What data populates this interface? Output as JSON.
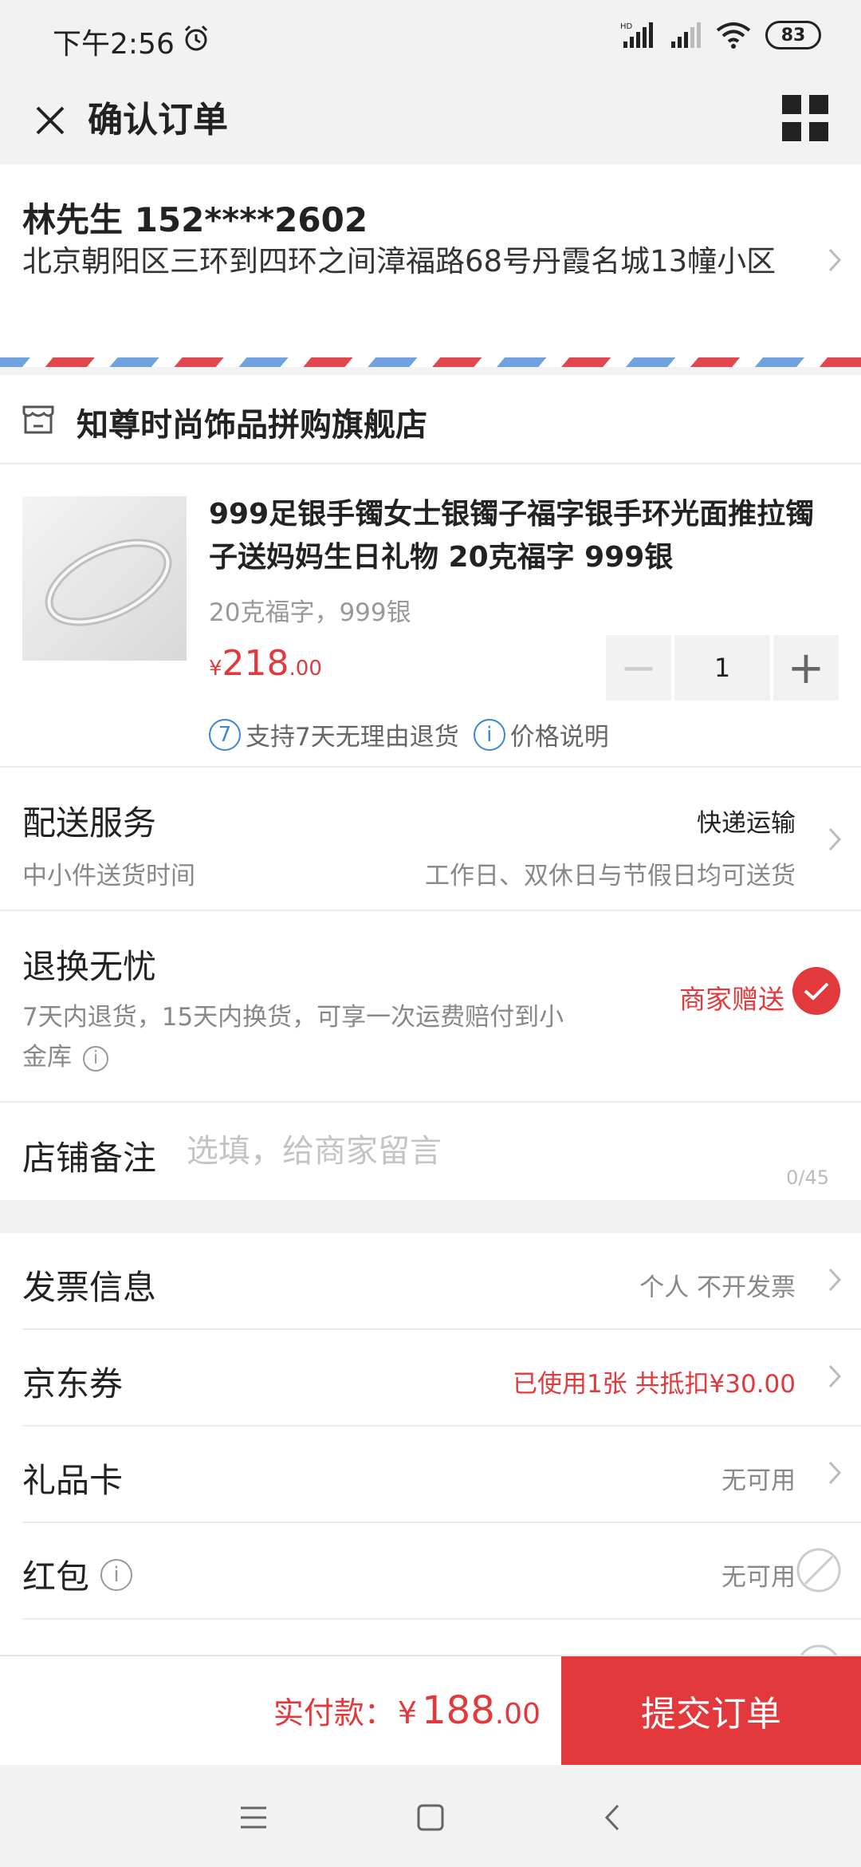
{
  "status_bar": {
    "time": "下午2:56",
    "battery": "83",
    "hd_label": "HD"
  },
  "header": {
    "title": "确认订单"
  },
  "address": {
    "name_phone": "林先生 152****2602",
    "detail": "北京朝阳区三环到四环之间漳福路68号丹霞名城13幢小区"
  },
  "store": {
    "name": "知尊时尚饰品拼购旗舰店"
  },
  "product": {
    "title": "999足银手镯女士银镯子福字银手环光面推拉镯子送妈妈生日礼物 20克福字 999银",
    "spec": "20克福字，999银",
    "price_currency": "¥",
    "price_int": "218",
    "price_dec": ".00",
    "quantity": "1",
    "return_badge": "7",
    "return_text": "支持7天无理由退货",
    "price_note": "价格说明",
    "minus": "−",
    "plus": "+"
  },
  "delivery": {
    "label": "配送服务",
    "method": "快递运输",
    "sub_label": "中小件送货时间",
    "sub_value": "工作日、双休日与节假日均可送货"
  },
  "return_service": {
    "label": "退换无忧",
    "desc": "7天内退货，15天内换货，可享一次运费赔付到小金库",
    "gift": "商家赠送"
  },
  "note": {
    "label": "店铺备注",
    "placeholder": "选填，给商家留言",
    "count": "0/45"
  },
  "list": {
    "invoice": {
      "label": "发票信息",
      "value": "个人 不开发票"
    },
    "coupon": {
      "label": "京东券",
      "value": "已使用1张 共抵扣¥30.00"
    },
    "giftcard": {
      "label": "礼品卡",
      "value": "无可用"
    },
    "redpacket": {
      "label": "红包",
      "value": "无可用"
    }
  },
  "bottom": {
    "pay_label": "实付款：",
    "pay_currency": "¥",
    "pay_int": "188",
    "pay_dec": ".00",
    "submit": "提交订单"
  },
  "colors": {
    "accent": "#e4393c",
    "link_blue": "#3a86d6"
  }
}
